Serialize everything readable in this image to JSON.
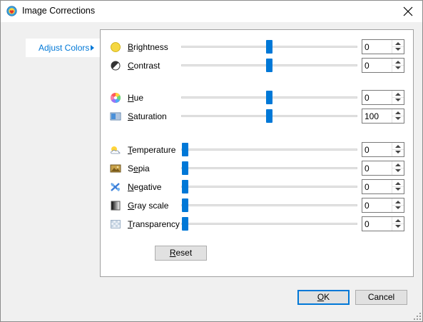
{
  "window": {
    "title": "Image Corrections",
    "close_icon": "close-icon"
  },
  "nav": {
    "items": [
      {
        "label": "Adjust Colors",
        "selected": true
      }
    ]
  },
  "colors": {
    "accent": "#0078d7",
    "panel_bg": "#ffffff",
    "window_bg": "#f0f0f0"
  },
  "adjustments": [
    {
      "label": "Brightness",
      "accel": "B",
      "rest": "rightness",
      "icon": "brightness-icon",
      "value": "0",
      "slider_fraction": 0.5
    },
    {
      "label": "Contrast",
      "accel": "C",
      "rest": "ontrast",
      "icon": "contrast-icon",
      "value": "0",
      "slider_fraction": 0.5
    },
    {
      "label": "Hue",
      "accel": "H",
      "rest": "ue",
      "icon": "hue-icon",
      "value": "0",
      "slider_fraction": 0.5
    },
    {
      "label": "Saturation",
      "accel": "S",
      "rest": "aturation",
      "icon": "saturation-icon",
      "value": "100",
      "slider_fraction": 0.5
    },
    {
      "label": "Temperature",
      "accel": "T",
      "rest": "emperature",
      "icon": "temperature-icon",
      "value": "0",
      "slider_fraction": 0.0
    },
    {
      "label": "Sepia",
      "accel": "e",
      "pre": "S",
      "rest": "pia",
      "icon": "sepia-icon",
      "value": "0",
      "slider_fraction": 0.0
    },
    {
      "label": "Negative",
      "accel": "N",
      "rest": "egative",
      "icon": "negative-icon",
      "value": "0",
      "slider_fraction": 0.0
    },
    {
      "label": "Gray scale",
      "accel": "G",
      "rest": "ray scale",
      "icon": "gray-scale-icon",
      "value": "0",
      "slider_fraction": 0.0
    },
    {
      "label": "Transparency",
      "accel": "T",
      "rest": "ransparency",
      "icon": "transparency-icon",
      "value": "0",
      "slider_fraction": 0.0
    }
  ],
  "buttons": {
    "reset": {
      "accel": "R",
      "rest": "eset"
    },
    "ok": {
      "accel": "O",
      "rest": "K"
    },
    "cancel": {
      "label": "Cancel"
    }
  }
}
